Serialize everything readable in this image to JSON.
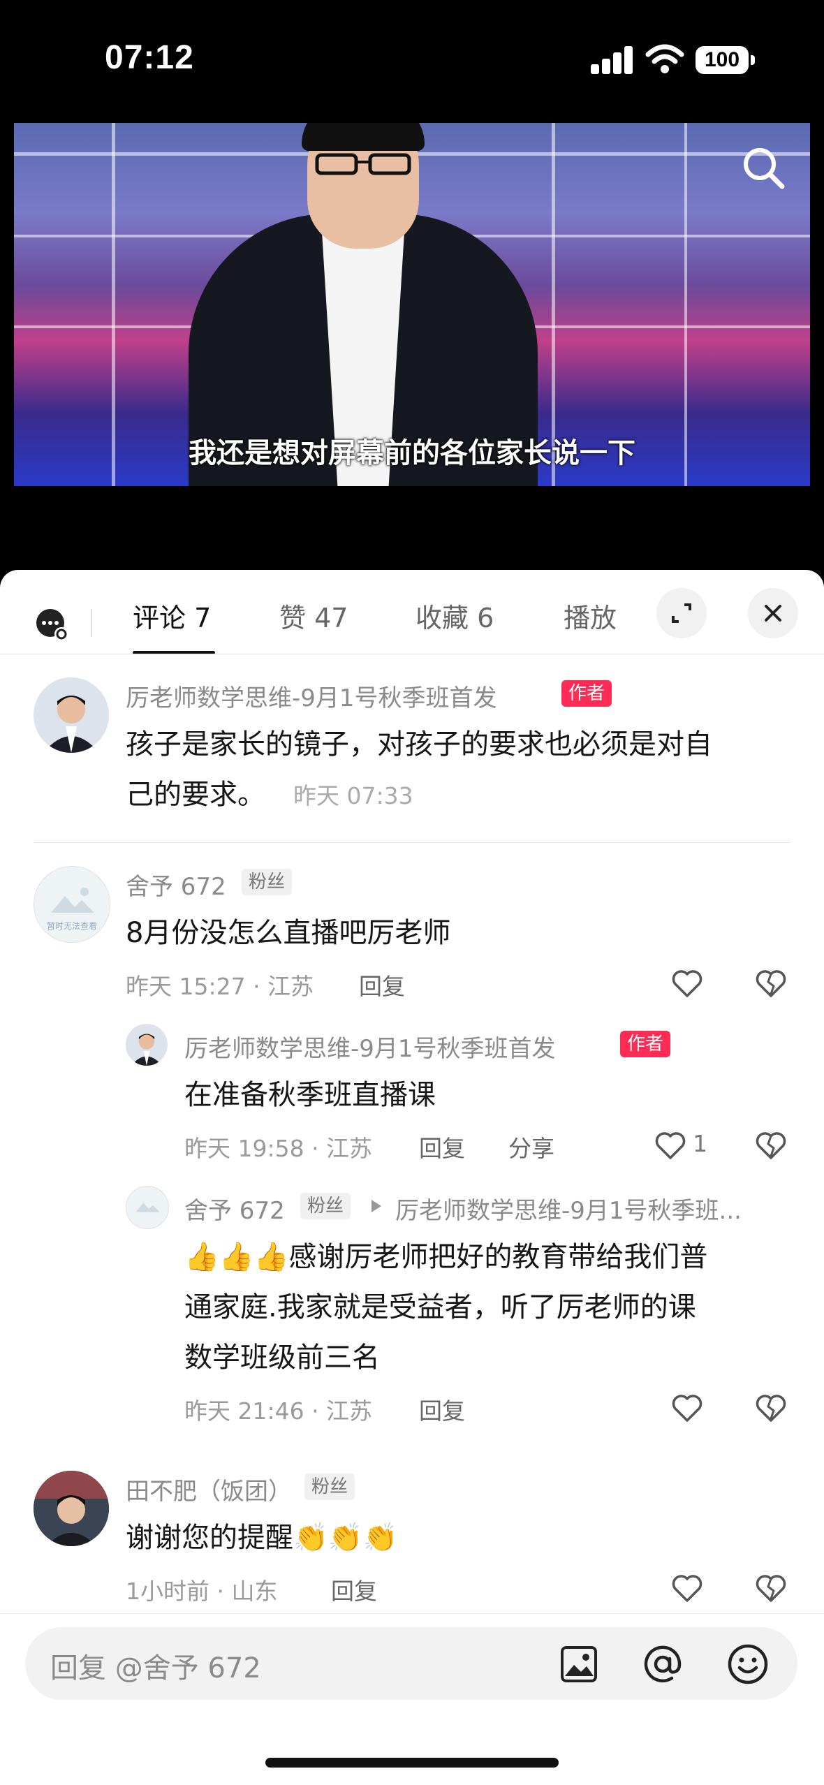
{
  "status_bar": {
    "time": "07:12",
    "battery": "100"
  },
  "video": {
    "subtitle": "我还是想对屏幕前的各位家长说一下"
  },
  "tabs": [
    {
      "label": "评论 7",
      "active": true
    },
    {
      "label": "赞 47",
      "active": false
    },
    {
      "label": "收藏 6",
      "active": false
    },
    {
      "label": "播放",
      "active": false
    }
  ],
  "comments": {
    "c1": {
      "user": "厉老师数学思维-9月1号秋季班首发",
      "badge": "作者",
      "text_line1": "孩子是家长的镜子，对孩子的要求也必须是对自",
      "text_line2": "己的要求。",
      "time": "昨天 07:33"
    },
    "c2": {
      "user": "舍予 672",
      "badge": "粉丝",
      "avatar_text": "暂时无法查看",
      "text": "8月份没怎么直播吧厉老师",
      "meta": "昨天 15:27 · 江苏",
      "reply": "回复"
    },
    "r1": {
      "user": "厉老师数学思维-9月1号秋季班首发",
      "badge": "作者",
      "text": "在准备秋季班直播课",
      "meta": "昨天 19:58 · 江苏",
      "reply": "回复",
      "share": "分享",
      "likes": "1"
    },
    "r2": {
      "user": "舍予 672",
      "badge": "粉丝",
      "reply_to": "厉老师数学思维-9月1号秋季班...",
      "emoji": "👍",
      "text_line1": "感谢厉老师把好的教育带给我们普",
      "text_line2": "通家庭.我家就是受益者，听了厉老师的课",
      "text_line3": "数学班级前三名",
      "meta": "昨天 21:46 · 江苏",
      "reply": "回复"
    },
    "c3": {
      "user": "田不肥（饭团）",
      "badge": "粉丝",
      "text": "谢谢您的提醒",
      "emoji": "👏",
      "meta": "1小时前 · 山东",
      "reply": "回复"
    }
  },
  "input": {
    "placeholder": "回复 @舍予 672"
  },
  "colors": {
    "accent": "#fe2c55",
    "sheet_bg": "#ffffff"
  }
}
